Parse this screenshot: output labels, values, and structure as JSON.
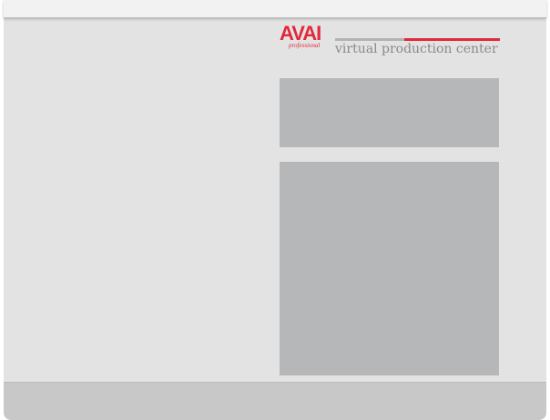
{
  "brand": {
    "logo_text": "AVAI",
    "logo_sub": "professional",
    "tagline": "virtual production center",
    "accent_color": "#e2283a"
  },
  "colors": {
    "top_bar": "#f2f2f2",
    "main_area": "#e3e3e3",
    "bottom_bar": "#c8c8c8",
    "panel": "#b6b7b9",
    "tagline": "#8a8a8a"
  }
}
